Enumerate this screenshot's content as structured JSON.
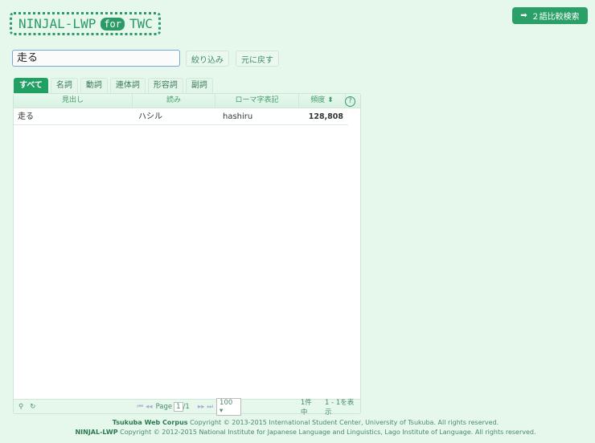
{
  "logo": {
    "main": "NINJAL-LWP",
    "for": "for",
    "suffix": "TWC"
  },
  "compare_button": {
    "icon": "arrow-right-icon",
    "label": "２語比較検索"
  },
  "search": {
    "value": "走る"
  },
  "buttons": {
    "filter": "絞り込み",
    "reset": "元に戻す"
  },
  "tabs": [
    "すべて",
    "名詞",
    "動詞",
    "連体詞",
    "形容詞",
    "副詞"
  ],
  "grid": {
    "columns": [
      "見出し",
      "読み",
      "ローマ字表記",
      "頻度"
    ],
    "sort_icon": "sort-icon",
    "help": "?",
    "rows": [
      {
        "headword": "走る",
        "reading": "ハシル",
        "romaji": "hashiru",
        "freq": "128,808"
      }
    ]
  },
  "pager": {
    "page_label": "Page",
    "page": "1",
    "total": "/1",
    "page_size": "100 ▾",
    "summary_count": "1件中",
    "summary_range": "1 - 1を表示"
  },
  "footer": {
    "line1_brand": "Tsukuba Web Corpus",
    "line1_text": " Copyright © 2013-2015 International Student Center, University of Tsukuba. All rights reserved.",
    "line2_brand": "NINJAL-LWP",
    "line2_text": " Copyright © 2012-2015 National Institute for Japanese Language and Linguistics, Lago Institute of Language. All rights reserved."
  }
}
